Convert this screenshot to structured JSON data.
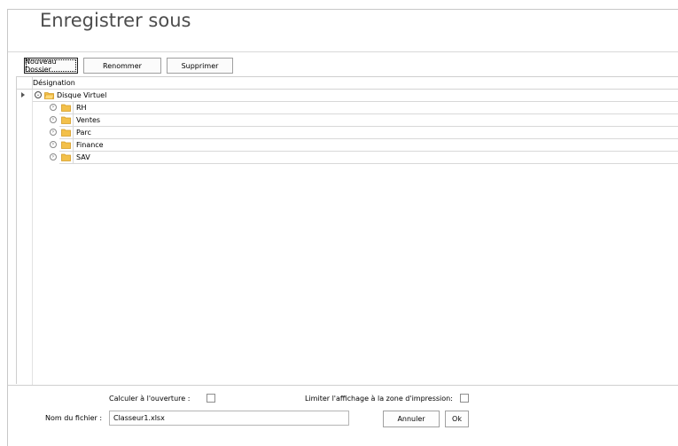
{
  "dialog": {
    "title": "Enregistrer sous"
  },
  "toolbar": {
    "new_folder_label": "Nouveau Dossier",
    "rename_label": "Renommer",
    "delete_label": "Supprimer"
  },
  "tree": {
    "column_header": "Désignation",
    "root": {
      "label": "Disque Virtuel",
      "expanded": true
    },
    "children": [
      {
        "label": "RH"
      },
      {
        "label": "Ventes"
      },
      {
        "label": "Parc"
      },
      {
        "label": "Finance"
      },
      {
        "label": "SAV"
      }
    ]
  },
  "options": {
    "calc_on_open_label": "Calculer à l'ouverture :",
    "calc_on_open_checked": false,
    "limit_print_label": "Limiter l'affichage à la zone d'impression:",
    "limit_print_checked": false
  },
  "filename": {
    "label": "Nom du fichier :",
    "value": "Classeur1.xlsx"
  },
  "actions": {
    "cancel_label": "Annuler",
    "ok_label": "Ok"
  },
  "colors": {
    "folder": "#f3c04a",
    "folder_edge": "#d49a22"
  }
}
